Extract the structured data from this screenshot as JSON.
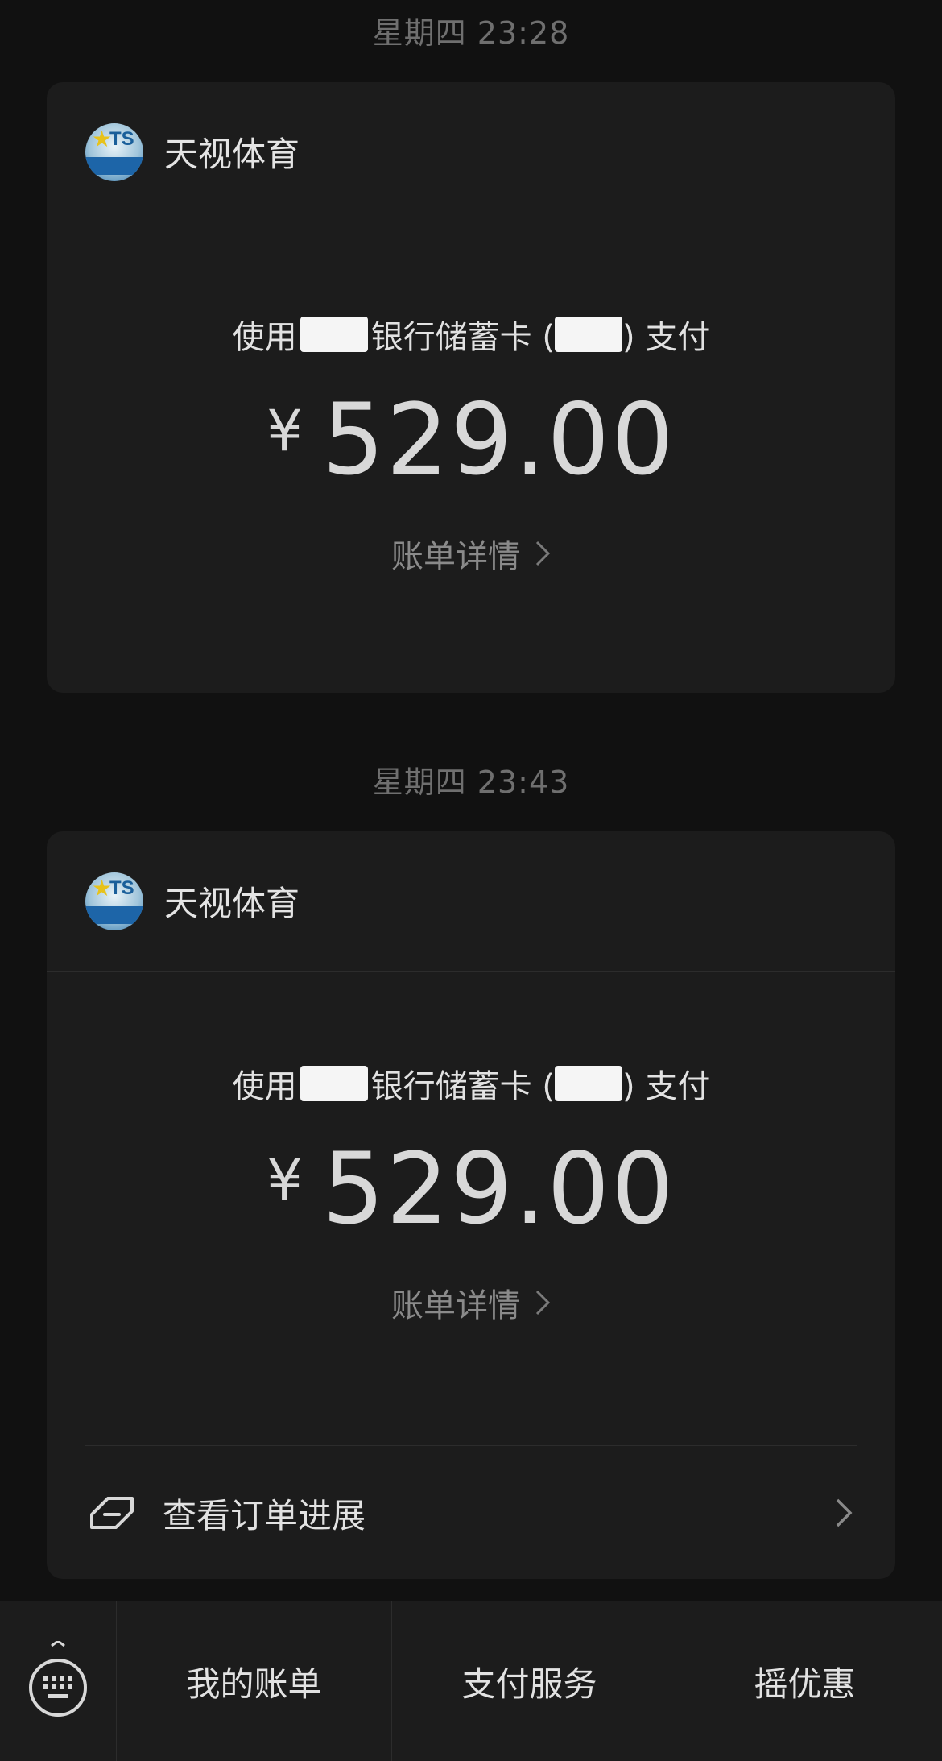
{
  "messages": [
    {
      "timestamp": "星期四 23:28",
      "merchant": "天视体育",
      "payment_prefix": "使用",
      "payment_bank_suffix": "银行储蓄卡 (",
      "payment_suffix": ") 支付",
      "currency": "¥",
      "amount": "529.00",
      "detail_link": "账单详情"
    },
    {
      "timestamp": "星期四 23:43",
      "merchant": "天视体育",
      "payment_prefix": "使用",
      "payment_bank_suffix": "银行储蓄卡 (",
      "payment_suffix": ") 支付",
      "currency": "¥",
      "amount": "529.00",
      "detail_link": "账单详情",
      "order_progress": "查看订单进展"
    }
  ],
  "logo": {
    "ts_text": "TS"
  },
  "bottom_menu": {
    "items": [
      "我的账单",
      "支付服务",
      "摇优惠"
    ]
  },
  "colors": {
    "background": "#111111",
    "card": "#1c1c1c",
    "muted_text": "#8a8a8a"
  }
}
